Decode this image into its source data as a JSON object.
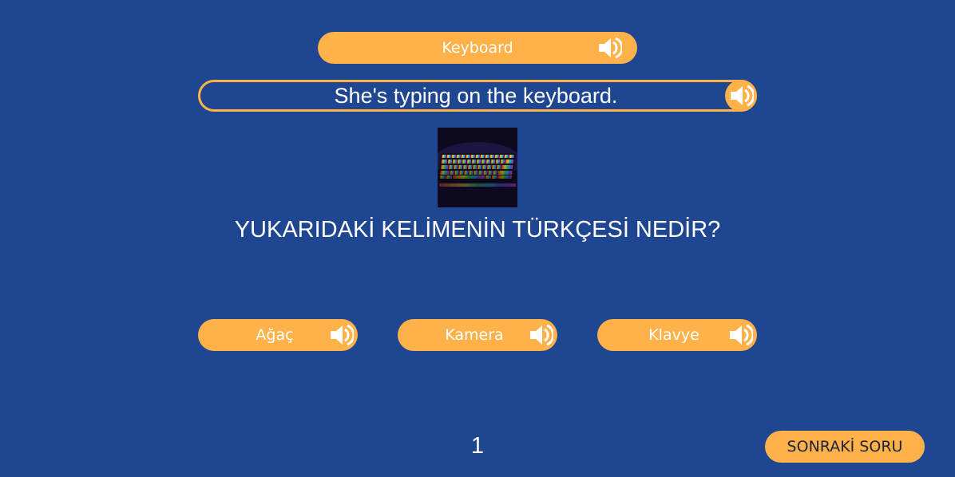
{
  "word": {
    "label": "Keyboard",
    "speaker_icon": "speaker-icon"
  },
  "sentence": {
    "label": "She's typing on the keyboard.",
    "speaker_icon": "speaker-icon"
  },
  "picture": {
    "subject_icon": "rgb-mechanical-keyboard-photo"
  },
  "question": "YUKARIDAKİ KELİMENİN TÜRKÇESİ NEDİR?",
  "answers": [
    {
      "label": "Ağaç"
    },
    {
      "label": "Kamera"
    },
    {
      "label": "Klavye"
    }
  ],
  "counter": "1",
  "next_button": {
    "label": "SONRAKİ SORU"
  },
  "colors": {
    "background": "#1f4690",
    "accent": "#ffb14a",
    "text": "#ffffff",
    "next_text": "#1d2238"
  }
}
